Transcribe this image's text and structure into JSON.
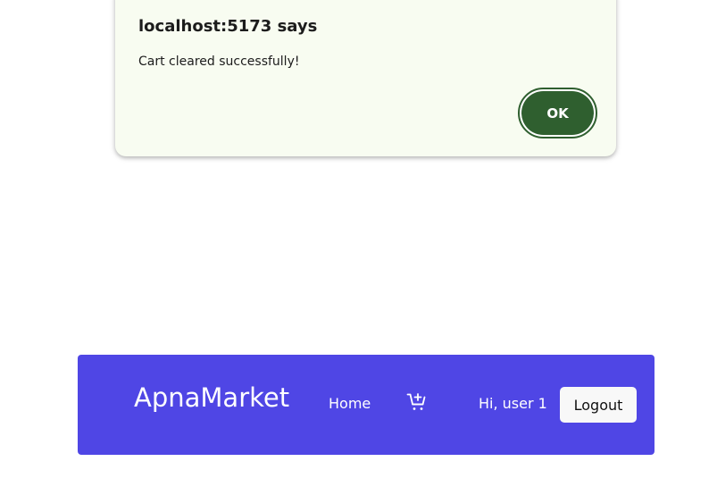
{
  "alert": {
    "title": "localhost:5173 says",
    "message": "Cart cleared successfully!",
    "ok_label": "OK",
    "colors": {
      "background": "#f8fcf1",
      "button": "#2f5f2f"
    }
  },
  "navbar": {
    "brand": "ApnaMarket",
    "home_label": "Home",
    "cart_icon": "cart-plus-icon",
    "greeting": "Hi, user 1",
    "logout_label": "Logout",
    "colors": {
      "background": "#4f46e5",
      "logout_bg": "#f8f8f8"
    }
  }
}
